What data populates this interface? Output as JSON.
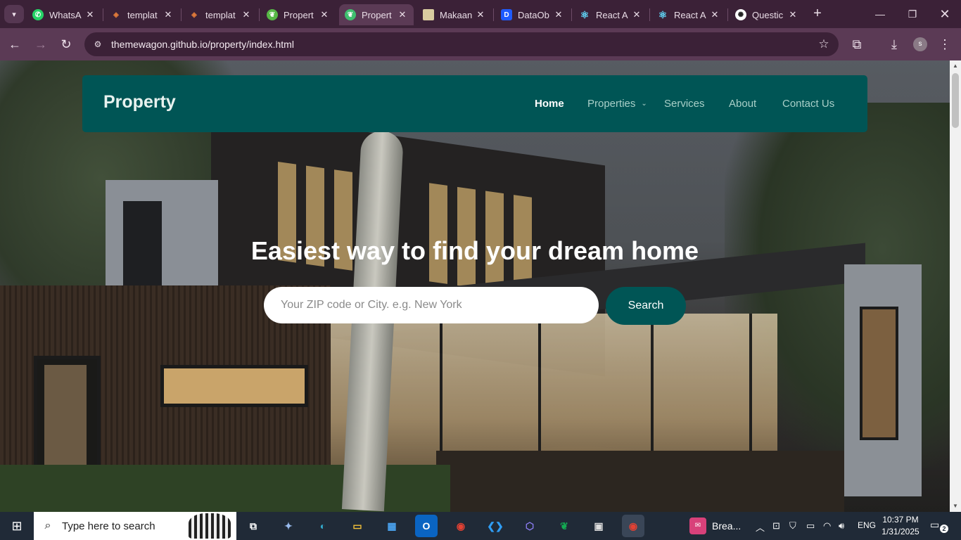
{
  "browser": {
    "tabs": [
      {
        "label": "WhatsA",
        "icon": "whatsapp-icon",
        "color": "#25d366"
      },
      {
        "label": "templat",
        "icon": "template-icon",
        "color": "#e07a3a"
      },
      {
        "label": "templat",
        "icon": "template-icon",
        "color": "#e07a3a"
      },
      {
        "label": "Propert",
        "icon": "leaf-icon",
        "color": "#57b846"
      },
      {
        "label": "Propert",
        "icon": "leaf-icon",
        "color": "#3fbf6f",
        "active": true
      },
      {
        "label": "Makaan",
        "icon": "image-icon",
        "color": "#d9cba0"
      },
      {
        "label": "DataOb",
        "icon": "dataobj-icon",
        "color": "#1f5bff"
      },
      {
        "label": "React A",
        "icon": "react-icon",
        "color": "#61dafb"
      },
      {
        "label": "React A",
        "icon": "react-icon",
        "color": "#61dafb"
      },
      {
        "label": "Questic",
        "icon": "openai-icon",
        "color": "#ffffff"
      }
    ],
    "url": "themewagon.github.io/property/index.html",
    "profile_initial": "s"
  },
  "site": {
    "brand": "Property",
    "nav": [
      {
        "label": "Home",
        "active": true
      },
      {
        "label": "Properties",
        "dropdown": true
      },
      {
        "label": "Services"
      },
      {
        "label": "About"
      },
      {
        "label": "Contact Us"
      }
    ],
    "hero_title": "Easiest way to find your dream home",
    "search_placeholder": "Your ZIP code or City. e.g. New York",
    "search_button": "Search",
    "accent_color": "#005555"
  },
  "taskbar": {
    "search_text": "Type here to search",
    "notification_app": "Brea...",
    "language": "ENG",
    "time": "10:37 PM",
    "date": "1/31/2025",
    "notification_count": "2"
  }
}
